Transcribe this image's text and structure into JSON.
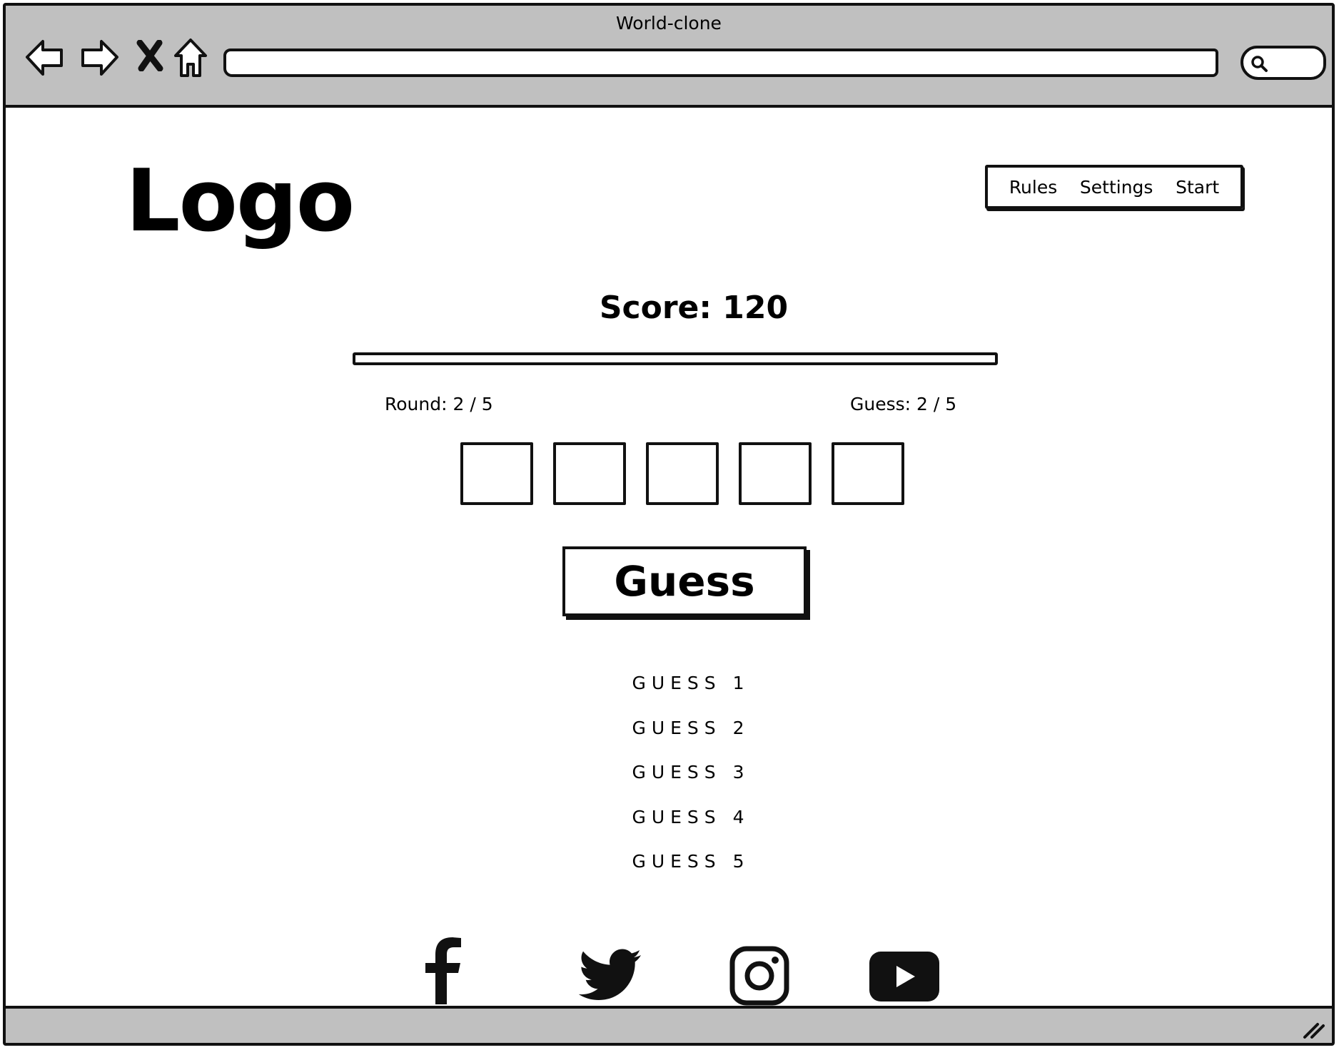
{
  "window": {
    "title": "World-clone"
  },
  "search": {
    "placeholder": ""
  },
  "header": {
    "logo": "Logo",
    "nav": [
      {
        "label": "Rules"
      },
      {
        "label": "Settings"
      },
      {
        "label": "Start"
      }
    ]
  },
  "game": {
    "score_text": "Score: 120",
    "progress_fraction": 0,
    "round_text": "Round: 2 / 5",
    "guess_count_text": "Guess: 2 / 5",
    "tiles": [
      "",
      "",
      "",
      "",
      ""
    ],
    "guess_button_label": "Guess",
    "guesses": [
      "GUESS 1",
      "GUESS 2",
      "GUESS 3",
      "GUESS 4",
      "GUESS 5"
    ]
  },
  "footer": {
    "social_icons": [
      "facebook-icon",
      "twitter-icon",
      "instagram-icon",
      "youtube-icon"
    ]
  }
}
